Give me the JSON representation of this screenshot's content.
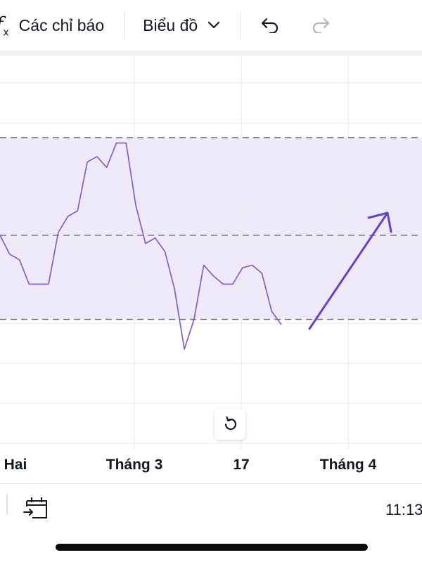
{
  "toolbar": {
    "indicators_label": "Các chỉ báo",
    "chart_type_label": "Biểu đồ",
    "icons": [
      "fx-icon",
      "chevron-down-icon",
      "undo-icon",
      "redo-icon"
    ]
  },
  "chart": {
    "colors": {
      "line": "#7e57c2",
      "band_fill": "#efeafa",
      "dashed": "#6b6b70",
      "grid": "#e6e8ee",
      "arrow": "#6a3fc4"
    },
    "x_labels": [
      "Hai",
      "Tháng 3",
      "17",
      "Tháng 4"
    ],
    "reset_icon": "rotate-ccw-icon"
  },
  "bottom": {
    "time": "11:13",
    "calendar_icon": "calendar-go-to-icon"
  },
  "chart_data": {
    "type": "line",
    "title": "",
    "xlabel": "",
    "ylabel": "",
    "x_tick_labels": [
      "Hai",
      "Tháng 3",
      "17",
      "Tháng 4"
    ],
    "series": [
      {
        "values": [
          6.9,
          6.2,
          6.0,
          5.1,
          5.1,
          5.1,
          7.0,
          7.6,
          7.8,
          9.6,
          9.8,
          9.4,
          10.3,
          10.3,
          8.0,
          6.6,
          6.8,
          6.3,
          4.9,
          2.7,
          3.8,
          5.8,
          5.4,
          5.1,
          5.1,
          5.7,
          5.8,
          5.5,
          4.1,
          3.6
        ]
      }
    ],
    "levels": [
      10.5,
      6.9,
      3.8
    ],
    "ylim": [
      -1,
      13.5
    ],
    "band_range": [
      3.8,
      10.5
    ],
    "annotation": "up-arrow",
    "grid": true
  }
}
